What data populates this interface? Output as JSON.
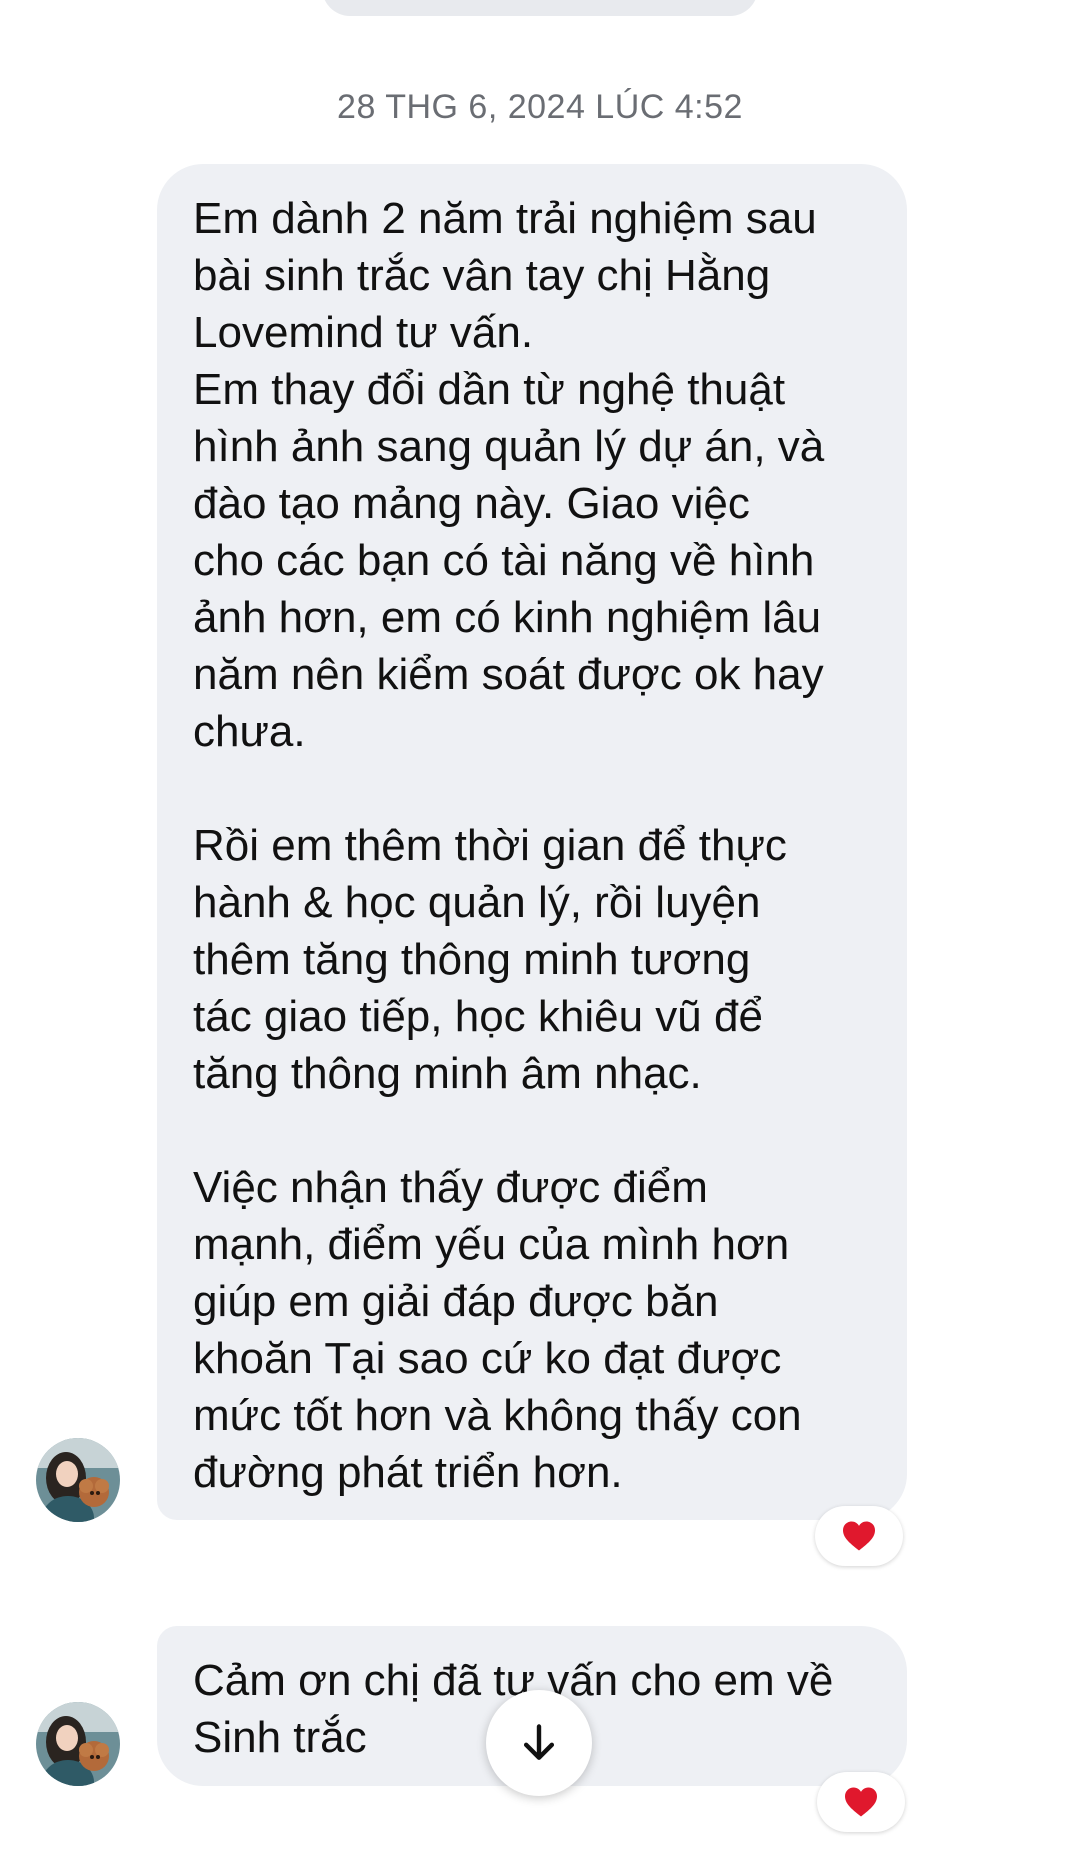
{
  "conversation": {
    "timestamp": "28 THG 6, 2024 LÚC 4:52",
    "messages": [
      {
        "text": "Em dành 2 năm trải nghiệm sau\nbài sinh trắc vân tay chị Hằng\nLovemind tư vấn.\nEm thay đổi dần từ nghệ thuật\nhình ảnh sang quản lý dự án, và\nđào tạo mảng này. Giao việc\ncho các bạn có tài năng về hình\nảnh hơn, em có kinh nghiệm lâu\nnăm nên kiểm soát được ok hay\nchưa.\n\nRồi em thêm thời gian để thực\nhành & học quản lý, rồi luyện\nthêm tăng thông minh tương\ntác giao tiếp, học khiêu vũ để\ntăng thông minh âm nhạc.\n\nViệc nhận thấy được điểm\nmạnh, điểm yếu của mình hơn\ngiúp em giải đáp được băn\nkhoăn Tại sao cứ ko đạt được\nmức tốt hơn và không thấy con\nđường phát triển hơn.",
        "reaction": "heart-icon"
      },
      {
        "text": "Cảm ơn chị đã tư vấn cho em về\nSinh trắc",
        "reaction": "heart-icon"
      }
    ]
  },
  "colors": {
    "bubble": "#eef0f4",
    "heart": "#e0182d",
    "timestamp": "#6a6d73"
  },
  "controls": {
    "scroll_down_icon": "arrow-down-icon"
  }
}
